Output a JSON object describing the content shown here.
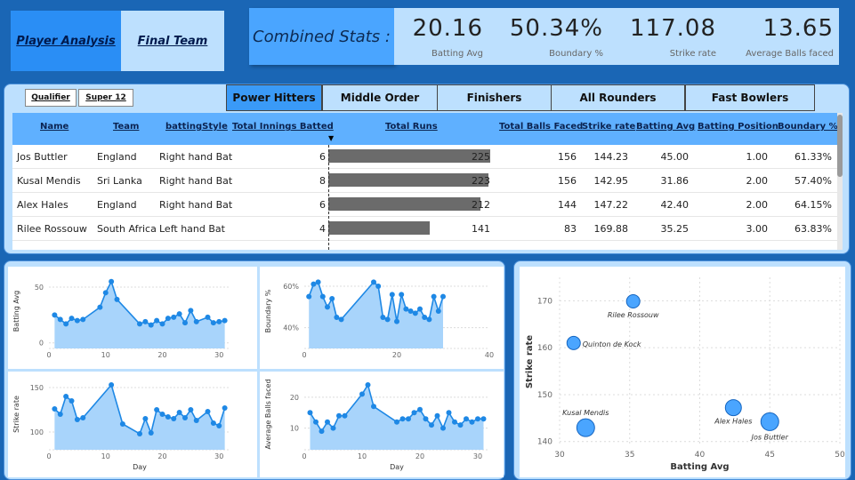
{
  "nav": {
    "player_analysis": "Player Analysis",
    "final_team": "Final Team"
  },
  "combined_stats": {
    "title": "Combined Stats :",
    "kpis": [
      {
        "value": "20.16",
        "label": "Batting Avg"
      },
      {
        "value": "50.34%",
        "label": "Boundary %"
      },
      {
        "value": "117.08",
        "label": "Strike rate"
      },
      {
        "value": "13.65",
        "label": "Average Balls faced"
      }
    ]
  },
  "stage_filters": [
    "Qualifier",
    "Super 12"
  ],
  "category_tabs": [
    "Power Hitters",
    "Middle Order",
    "Finishers",
    "All Rounders",
    "Fast Bowlers"
  ],
  "active_tab": "Power Hitters",
  "colors": {
    "background": "#1a66b5",
    "panel": "#bde0fe",
    "accent": "#3a9af7",
    "bar": "#6b6b6b",
    "line": "#1e88e5",
    "area": "#a8d4fb"
  },
  "table": {
    "columns": [
      "Name",
      "Team",
      "battingStyle",
      "Total Innings Batted",
      "Total Runs",
      "Total Balls Faced",
      "Strike rate",
      "Batting Avg",
      "Batting Position",
      "Boundary %"
    ],
    "rows": [
      {
        "name": "Jos Buttler",
        "team": "England",
        "style": "Right hand Bat",
        "innings": "6",
        "runs": "225",
        "balls": "156",
        "sr": "144.23",
        "avg": "45.00",
        "pos": "1.00",
        "boundary": "61.33%"
      },
      {
        "name": "Kusal Mendis",
        "team": "Sri Lanka",
        "style": "Right hand Bat",
        "innings": "8",
        "runs": "223",
        "balls": "156",
        "sr": "142.95",
        "avg": "31.86",
        "pos": "2.00",
        "boundary": "57.40%"
      },
      {
        "name": "Alex Hales",
        "team": "England",
        "style": "Right hand Bat",
        "innings": "6",
        "runs": "212",
        "balls": "144",
        "sr": "147.22",
        "avg": "42.40",
        "pos": "2.00",
        "boundary": "64.15%"
      },
      {
        "name": "Rilee Rossouw",
        "team": "South Africa",
        "style": "Left hand Bat",
        "innings": "4",
        "runs": "141",
        "balls": "83",
        "sr": "169.88",
        "avg": "35.25",
        "pos": "3.00",
        "boundary": "63.83%"
      }
    ]
  },
  "chart_data": [
    {
      "type": "area",
      "ylabel": "Batting Avg",
      "xlabel": "",
      "x": [
        1,
        2,
        3,
        4,
        5,
        6,
        7,
        8,
        9,
        10,
        11,
        12,
        13,
        14,
        15,
        16,
        17,
        18,
        19,
        20,
        21,
        22,
        23,
        24,
        25,
        26,
        27,
        28,
        29,
        30,
        31
      ],
      "y": [
        25,
        21,
        17,
        22,
        20,
        21,
        null,
        null,
        32,
        45,
        55,
        39,
        null,
        null,
        null,
        17,
        19,
        16,
        20,
        17,
        22,
        23,
        26,
        18,
        29,
        19,
        null,
        23,
        18,
        19,
        20
      ],
      "xticks": [
        0,
        10,
        20,
        30
      ],
      "yticks": [
        0,
        50
      ],
      "xlim": [
        0,
        32
      ],
      "ylim": [
        -5,
        62
      ]
    },
    {
      "type": "area",
      "ylabel": "Boundary %",
      "xlabel": "",
      "x": [
        1,
        2,
        3,
        4,
        5,
        6,
        7,
        8,
        9,
        10,
        11,
        12,
        13,
        14,
        15,
        16,
        17,
        18,
        19,
        20,
        21,
        22,
        23,
        24,
        25,
        26,
        27,
        28,
        29,
        30
      ],
      "y": [
        55,
        61,
        62,
        55,
        50,
        54,
        45,
        44,
        null,
        null,
        null,
        null,
        null,
        null,
        62,
        60,
        45,
        44,
        56,
        43,
        56,
        49,
        48,
        47,
        49,
        45,
        44,
        55,
        48,
        55
      ],
      "xticks": [
        0,
        20,
        40
      ],
      "yticks": [
        "40%",
        "60%"
      ],
      "xlim": [
        0,
        40
      ],
      "ylim": [
        30,
        66
      ]
    },
    {
      "type": "area",
      "ylabel": "Strike rate",
      "xlabel": "Day",
      "x": [
        1,
        2,
        3,
        4,
        5,
        6,
        7,
        8,
        9,
        10,
        11,
        12,
        13,
        14,
        15,
        16,
        17,
        18,
        19,
        20,
        21,
        22,
        23,
        24,
        25,
        26,
        27,
        28,
        29,
        30,
        31
      ],
      "y": [
        126,
        120,
        140,
        135,
        114,
        116,
        null,
        null,
        null,
        null,
        153,
        null,
        109,
        null,
        null,
        98,
        115,
        99,
        125,
        120,
        117,
        115,
        122,
        116,
        125,
        113,
        null,
        123,
        110,
        107,
        127
      ],
      "xticks": [
        0,
        10,
        20,
        30
      ],
      "yticks": [
        100,
        150
      ],
      "xlim": [
        0,
        32
      ],
      "ylim": [
        80,
        160
      ]
    },
    {
      "type": "area",
      "ylabel": "Average Balls faced",
      "xlabel": "Day",
      "x": [
        1,
        2,
        3,
        4,
        5,
        6,
        7,
        8,
        9,
        10,
        11,
        12,
        13,
        14,
        15,
        16,
        17,
        18,
        19,
        20,
        21,
        22,
        23,
        24,
        25,
        26,
        27,
        28,
        29,
        30,
        31
      ],
      "y": [
        15,
        12,
        9,
        12,
        10,
        14,
        14,
        null,
        null,
        21,
        24,
        17,
        null,
        null,
        null,
        12,
        13,
        13,
        15,
        16,
        13,
        11,
        14,
        10,
        15,
        12,
        11,
        13,
        12,
        13,
        13
      ],
      "xticks": [
        0,
        10,
        20,
        30
      ],
      "yticks": [
        10,
        20
      ],
      "xlim": [
        0,
        32
      ],
      "ylim": [
        3,
        26
      ]
    },
    {
      "type": "scatter",
      "xlabel": "Batting Avg",
      "ylabel": "Strike rate",
      "xlim": [
        30,
        50
      ],
      "ylim": [
        139,
        175
      ],
      "xticks": [
        30,
        35,
        40,
        45,
        50
      ],
      "yticks": [
        140,
        150,
        160,
        170
      ],
      "points": [
        {
          "label": "Rilee Rossouw",
          "x": 35.25,
          "y": 169.88
        },
        {
          "label": "Quinton de Kock",
          "x": 31.0,
          "y": 161.0
        },
        {
          "label": "Kusal Mendis",
          "x": 31.86,
          "y": 142.95
        },
        {
          "label": "Alex Hales",
          "x": 42.4,
          "y": 147.22
        },
        {
          "label": "Jos Buttler",
          "x": 45.0,
          "y": 144.23
        }
      ]
    }
  ]
}
